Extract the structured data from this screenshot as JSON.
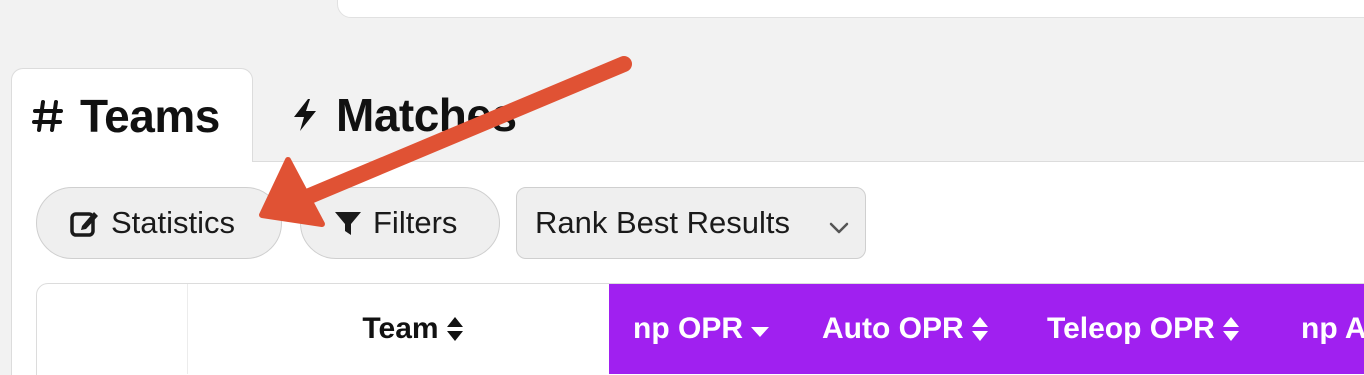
{
  "tabs": [
    {
      "label": "Teams",
      "icon": "hash-icon",
      "active": true
    },
    {
      "label": "Matches",
      "icon": "bolt-icon",
      "active": false
    }
  ],
  "toolbar": {
    "statistics_label": "Statistics",
    "filters_label": "Filters",
    "rank_select_value": "Rank Best Results"
  },
  "table": {
    "columns": [
      {
        "label": "",
        "sort": "none"
      },
      {
        "label": "Team",
        "sort": "both"
      },
      {
        "label": "np OPR",
        "sort": "desc"
      },
      {
        "label": "Auto OPR",
        "sort": "both"
      },
      {
        "label": "Teleop OPR",
        "sort": "both"
      },
      {
        "label": "np A",
        "sort": "none"
      }
    ],
    "header_highlight_color": "#a020f0"
  },
  "annotation": {
    "color": "#e05234",
    "points_to": "statistics-button"
  }
}
